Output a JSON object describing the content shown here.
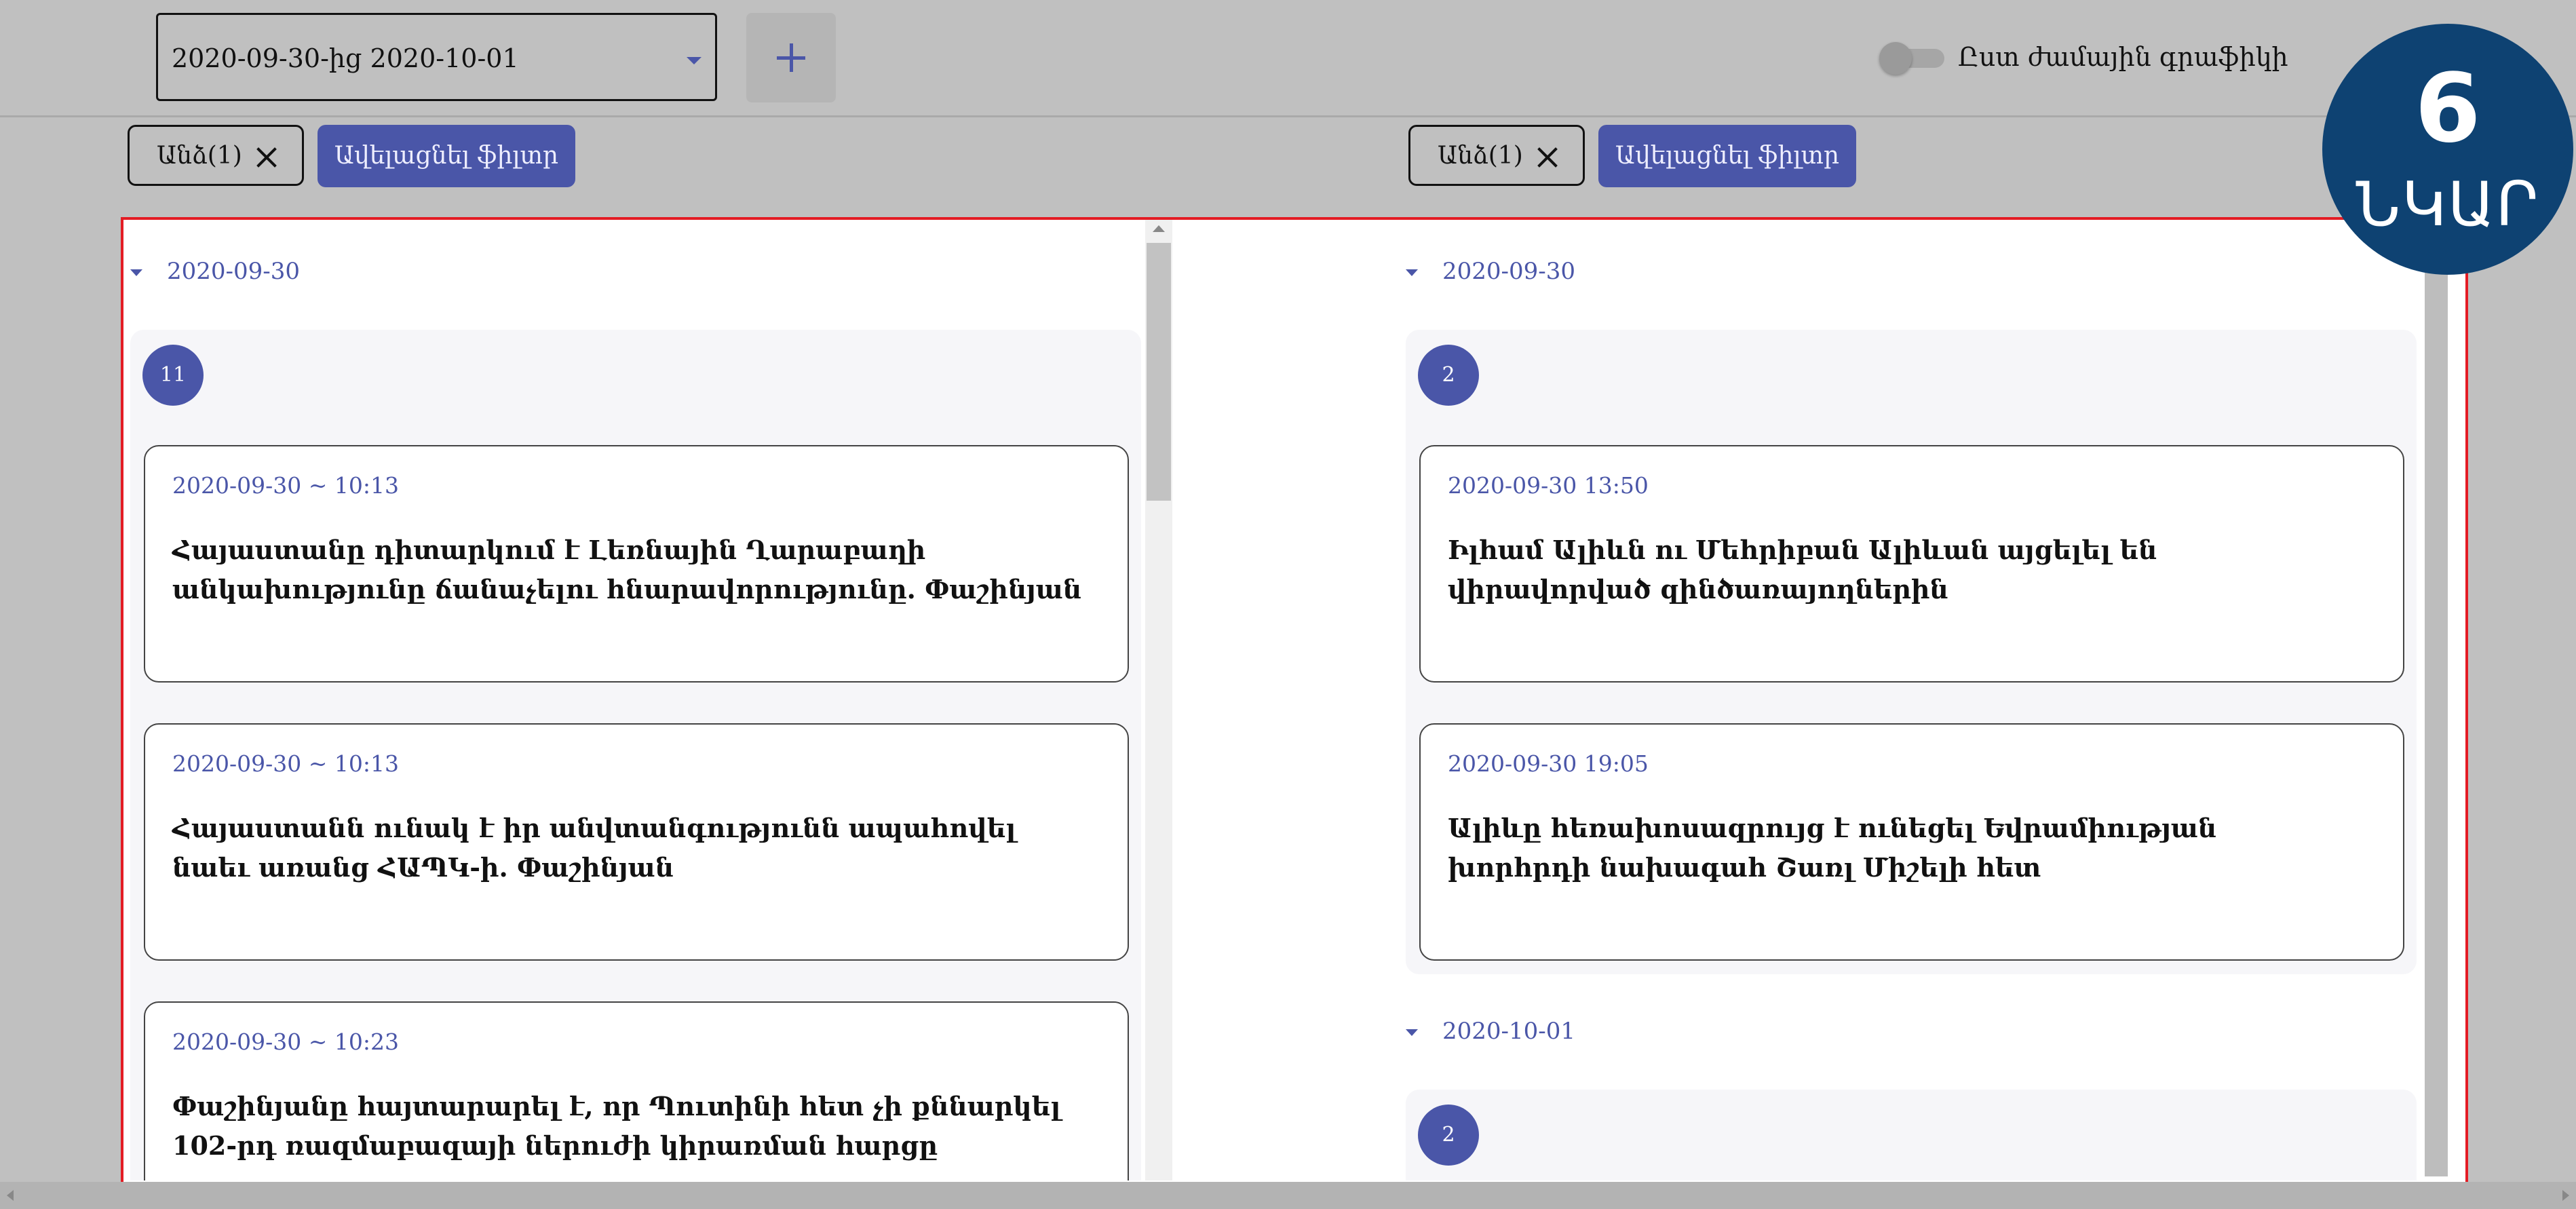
{
  "header": {
    "date_range": "2020-09-30-ից 2020-10-01",
    "toggle_label": "Ըստ ժամային գրաֆիկի"
  },
  "badge": {
    "number": "6",
    "word": "ՆԿԱՐ"
  },
  "filters": {
    "chip_label": "Անձ(1)",
    "remove_label": "Ավելացնել ֆիլտր"
  },
  "left": {
    "day": "2020-09-30",
    "count": "11",
    "cards": [
      {
        "time": "2020-09-30 ~ 10:13",
        "title": "Հայաստանը դիտարկում է Լեռնային Ղարաբաղի անկախությունը ճանաչելու հնարավորությունը. Փաշինյան"
      },
      {
        "time": "2020-09-30 ~ 10:13",
        "title": "Հայաստանն ունակ է իր անվտանգությունն ապահովել նաեւ առանց ՀԱՊԿ-ի. Փաշինյան"
      },
      {
        "time": "2020-09-30 ~ 10:23",
        "title": "Փաշինյանը հայտարարել է, որ Պուտինի հետ չի քննարկել 102-րդ ռազմաբազայի ներուժի կիրառման հարցը"
      }
    ]
  },
  "right": {
    "days": [
      {
        "day": "2020-09-30",
        "count": "2",
        "cards": [
          {
            "time": "2020-09-30 13:50",
            "title": "Իլհամ Ալիևն ու Մեհրիբան Ալիևան այցելել են վիրավորված զինծառայողներին"
          },
          {
            "time": "2020-09-30 19:05",
            "title": "Ալիևը հեռախոսազրույց է ունեցել Եվրամիության խորհրդի նախագահ Շառլ Միշելի հետ"
          }
        ]
      },
      {
        "day": "2020-10-01",
        "count": "2"
      }
    ]
  }
}
